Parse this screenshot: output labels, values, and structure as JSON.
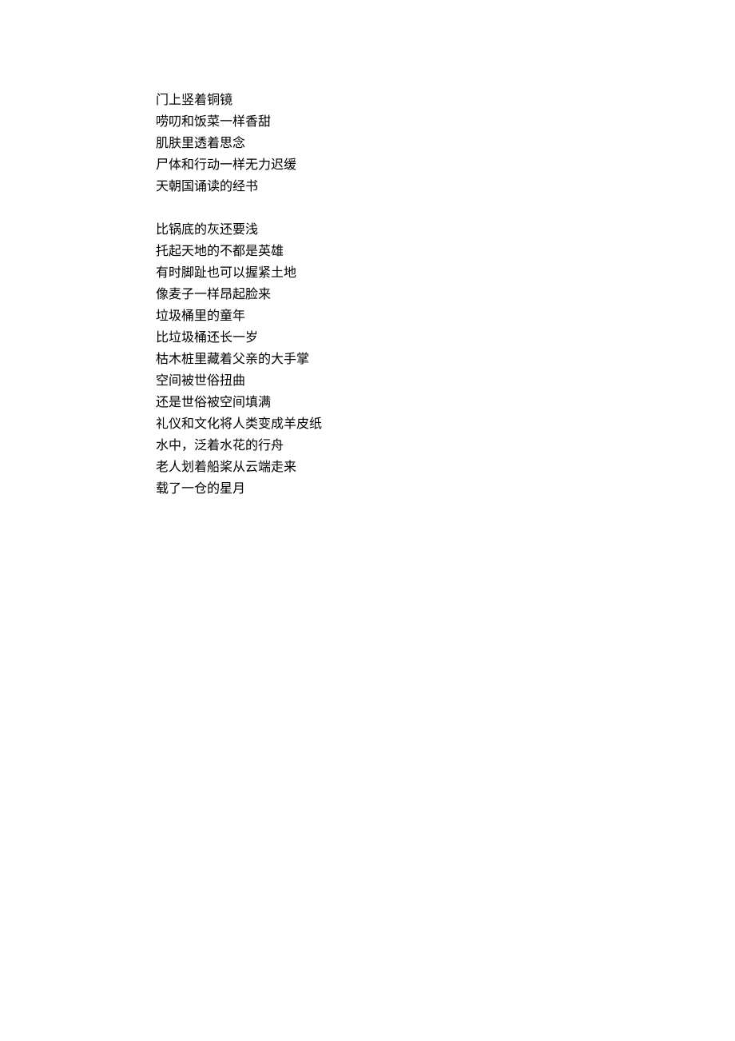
{
  "poem": {
    "stanzas": [
      {
        "lines": [
          "门上竖着铜镜",
          "唠叨和饭菜一样香甜",
          "肌肤里透着思念",
          "尸体和行动一样无力迟缓",
          "天朝国诵读的经书"
        ]
      },
      {
        "lines": [
          "比锅底的灰还要浅",
          "托起天地的不都是英雄",
          "有时脚趾也可以握紧土地",
          "像麦子一样昂起脸来",
          "垃圾桶里的童年",
          "比垃圾桶还长一岁",
          "枯木桩里藏着父亲的大手掌",
          "空间被世俗扭曲",
          "还是世俗被空间填满",
          "礼仪和文化将人类变成羊皮纸",
          "水中，泛着水花的行舟",
          "老人划着船桨从云端走来",
          "载了一仓的星月"
        ]
      }
    ]
  }
}
